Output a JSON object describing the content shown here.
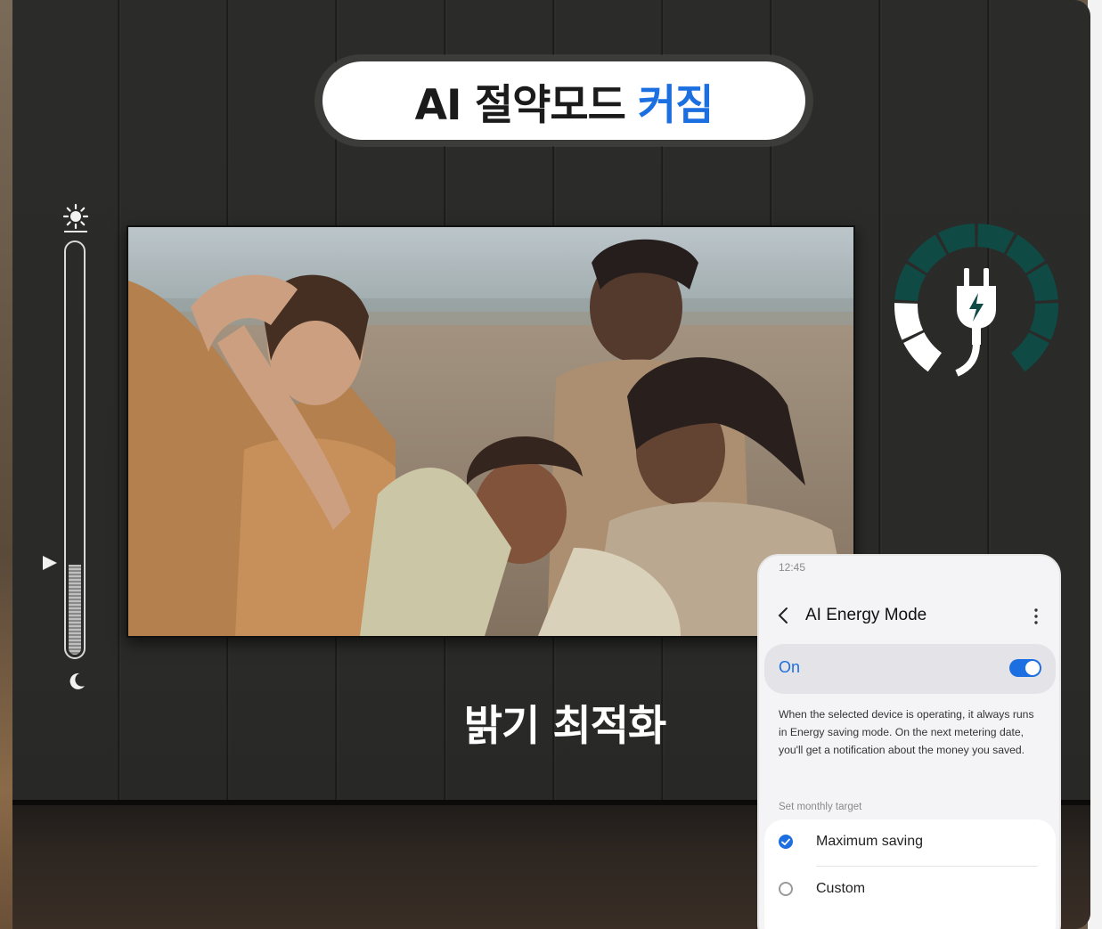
{
  "title": {
    "main": "AI 절약모드",
    "accent": "커짐"
  },
  "caption": "밝기 최적화",
  "slider": {
    "level": 0.22,
    "top_icon": "sun-icon",
    "bottom_icon": "moon-icon"
  },
  "gauge": {
    "icon": "plug-icon",
    "level_segments": 2,
    "total_segments": 10
  },
  "phone": {
    "time": "12:45",
    "screen_title": "AI Energy Mode",
    "toggle_label": "On",
    "toggle_on": true,
    "description": "When the selected device is operating, it always runs in Energy saving mode. On the next metering date, you'll get a notification about the money you saved.",
    "target_label": "Set monthly target",
    "options": [
      {
        "label": "Maximum saving",
        "selected": true
      },
      {
        "label": "Custom",
        "selected": false
      }
    ]
  },
  "colors": {
    "accent": "#1c6fe0",
    "gauge": "#0f4a44",
    "wall": "#2a2a28"
  }
}
